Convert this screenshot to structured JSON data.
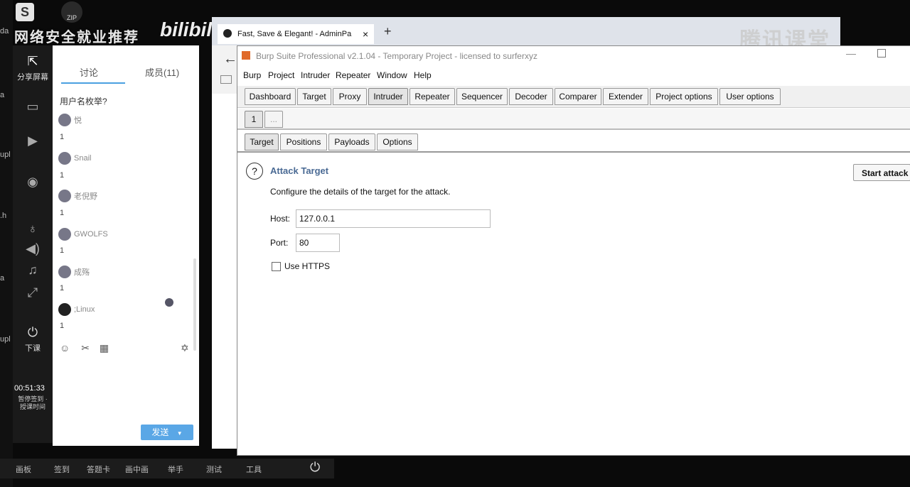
{
  "desktop": {
    "left_labels": [
      "da",
      "a",
      "upl",
      ".h",
      "a",
      "upl"
    ],
    "watermark": "网络安全就业推荐",
    "bili": "bilibili",
    "tencent": "腾讯课堂",
    "zip_label": "ZIP"
  },
  "classroom": {
    "tools": [
      {
        "label": "分享屏幕",
        "icon": "share-screen-icon",
        "glyph": "⇱"
      },
      {
        "label": "",
        "icon": "ppt-icon",
        "glyph": "▭"
      },
      {
        "label": "",
        "icon": "video-icon",
        "glyph": "▶"
      },
      {
        "label": "",
        "icon": "camera-icon",
        "glyph": "◉"
      },
      {
        "label": "",
        "icon": "mic-icon",
        "glyph": "♁"
      },
      {
        "label": "",
        "icon": "speaker-icon",
        "glyph": "◀)"
      },
      {
        "label": "",
        "icon": "music-icon",
        "glyph": "♫"
      },
      {
        "label": "",
        "icon": "expand-icon",
        "glyph": "⤢"
      },
      {
        "label": "下课",
        "icon": "end-class-icon",
        "glyph": "⏻"
      }
    ],
    "timer": "00:51:33",
    "timer_sub": "暂停签到 · 授课时间"
  },
  "chat": {
    "tab_discussion": "讨论",
    "tab_members": "成员(11)",
    "top_message": "用户名枚举?",
    "messages": [
      {
        "name": "悦",
        "text": "1"
      },
      {
        "name": "Snail",
        "text": "1"
      },
      {
        "name": "老倪野",
        "text": "1"
      },
      {
        "name": "GWOLFS",
        "text": "1"
      },
      {
        "name": "成殇",
        "text": "1"
      },
      {
        "name": ";Linux",
        "text": "1"
      }
    ],
    "send": "发送"
  },
  "browser": {
    "tab_title": "Fast, Save & Elegant! - AdminPa",
    "new_tab": "+",
    "close": "×"
  },
  "burp": {
    "title": "Burp Suite Professional v2.1.04 - Temporary Project - licensed to surferxyz",
    "menu": [
      "Burp",
      "Project",
      "Intruder",
      "Repeater",
      "Window",
      "Help"
    ],
    "tabs": [
      "Dashboard",
      "Target",
      "Proxy",
      "Intruder",
      "Repeater",
      "Sequencer",
      "Decoder",
      "Comparer",
      "Extender",
      "Project options",
      "User options"
    ],
    "active_tab": "Intruder",
    "sub_tabs": [
      "1",
      "..."
    ],
    "inner_tabs": [
      "Target",
      "Positions",
      "Payloads",
      "Options"
    ],
    "section_title": "Attack Target",
    "description": "Configure the details of the target for the attack.",
    "host_label": "Host:",
    "host_value": "127.0.0.1",
    "port_label": "Port:",
    "port_value": "80",
    "https_label": "Use HTTPS",
    "start_attack": "Start attack"
  },
  "taskbar": {
    "items": [
      "画板",
      "签到",
      "答题卡",
      "画中画",
      "举手",
      "测试",
      "工具"
    ]
  }
}
